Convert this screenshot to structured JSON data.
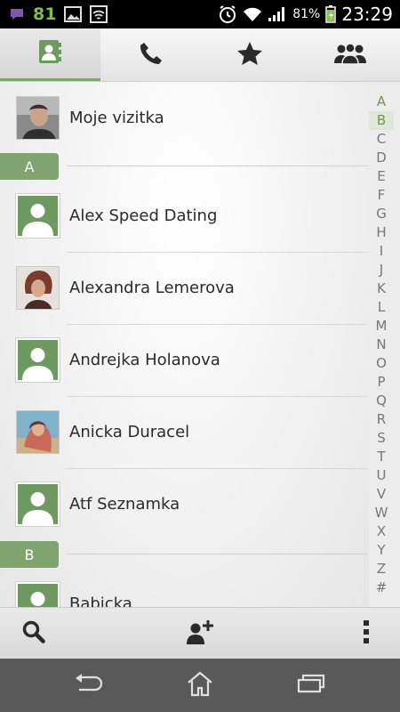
{
  "status_bar": {
    "notification_count": "81",
    "battery_percent": "81%",
    "time": "23:29"
  },
  "tabs": [
    {
      "name": "contacts",
      "icon": "contacts-card-icon",
      "selected": true
    },
    {
      "name": "phone",
      "icon": "phone-icon",
      "selected": false
    },
    {
      "name": "favorites",
      "icon": "star-icon",
      "selected": false
    },
    {
      "name": "groups",
      "icon": "groups-icon",
      "selected": false
    }
  ],
  "my_card": {
    "name": "Moje vizitka"
  },
  "sections": [
    {
      "letter": "A"
    },
    {
      "letter": "B"
    }
  ],
  "contacts": [
    {
      "name": "Alex Speed Dating",
      "avatar": "placeholder"
    },
    {
      "name": "Alexandra Lemerova",
      "avatar": "photo"
    },
    {
      "name": "Andrejka Holanova",
      "avatar": "placeholder"
    },
    {
      "name": "Anicka Duracel",
      "avatar": "photo"
    },
    {
      "name": "Atf Seznamka",
      "avatar": "placeholder"
    },
    {
      "name": "Babicka",
      "avatar": "placeholder"
    }
  ],
  "alphabet_index": [
    "A",
    "B",
    "C",
    "D",
    "E",
    "F",
    "G",
    "H",
    "I",
    "J",
    "K",
    "L",
    "M",
    "N",
    "O",
    "P",
    "Q",
    "R",
    "S",
    "T",
    "U",
    "V",
    "W",
    "X",
    "Y",
    "Z",
    "#"
  ],
  "toolbar": {
    "search_icon": "search-icon",
    "add_contact_icon": "add-contact-icon",
    "overflow_icon": "overflow-menu-icon"
  },
  "navbar": {
    "back_icon": "back-icon",
    "home_icon": "home-icon",
    "recents_icon": "recent-apps-icon"
  },
  "colors": {
    "accent": "#7ea66a",
    "section_tag": "#80a46f",
    "status_green": "#7fc241"
  }
}
